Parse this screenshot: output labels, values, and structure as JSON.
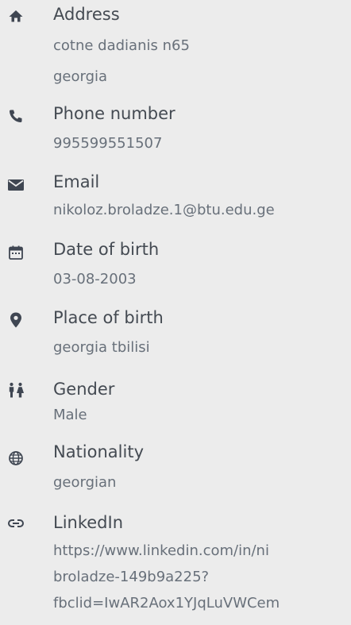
{
  "colors": {
    "background": "#ececec",
    "icon": "#3f4652",
    "label": "#444a52",
    "value": "#68707a"
  },
  "items": [
    {
      "icon": "home-icon",
      "label": "Address",
      "values": [
        "cotne dadianis n65",
        "georgia"
      ]
    },
    {
      "icon": "phone-icon",
      "label": "Phone number",
      "values": [
        "995599551507"
      ]
    },
    {
      "icon": "email-icon",
      "label": "Email",
      "values": [
        "nikoloz.broladze.1@btu.edu.ge"
      ]
    },
    {
      "icon": "calendar-icon",
      "label": "Date of birth",
      "values": [
        "03-08-2003"
      ]
    },
    {
      "icon": "map-pin-icon",
      "label": "Place of birth",
      "values": [
        "georgia tbilisi"
      ]
    },
    {
      "icon": "gender-icon",
      "label": "Gender",
      "values": [
        "Male"
      ]
    },
    {
      "icon": "globe-icon",
      "label": "Nationality",
      "values": [
        "georgian"
      ]
    },
    {
      "icon": "link-icon",
      "label": "LinkedIn",
      "values": [
        "https://www.linkedin.com/in/ni",
        "broladze-149b9a225?",
        "fbclid=IwAR2Aox1YJqLuVWCem"
      ]
    }
  ]
}
